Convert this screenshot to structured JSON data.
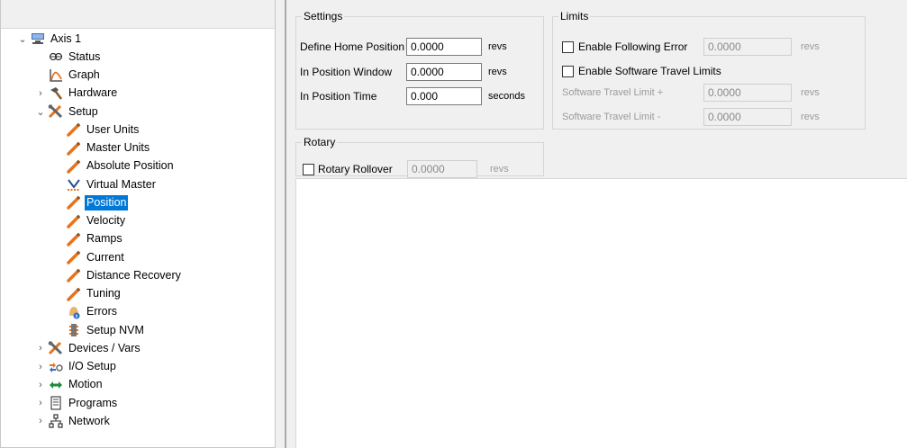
{
  "tree": {
    "items": [
      {
        "label": "Axis 1",
        "chevron": "⌄",
        "icon": "axis-icon"
      },
      {
        "label": "Status",
        "icon": "status-icon"
      },
      {
        "label": "Graph",
        "icon": "graph-icon"
      },
      {
        "label": "Hardware",
        "chevron": "›",
        "icon": "hardware-icon"
      },
      {
        "label": "Setup",
        "chevron": "⌄",
        "icon": "setup-icon"
      },
      {
        "label": "User Units",
        "icon": "pencil-icon"
      },
      {
        "label": "Master Units",
        "icon": "pencil-icon"
      },
      {
        "label": "Absolute Position",
        "icon": "pencil-icon"
      },
      {
        "label": "Virtual Master",
        "icon": "virtual-master-icon"
      },
      {
        "label": "Position",
        "icon": "pencil-icon",
        "selected": true
      },
      {
        "label": "Velocity",
        "icon": "pencil-icon"
      },
      {
        "label": "Ramps",
        "icon": "pencil-icon"
      },
      {
        "label": "Current",
        "icon": "pencil-icon"
      },
      {
        "label": "Distance Recovery",
        "icon": "pencil-icon"
      },
      {
        "label": "Tuning",
        "icon": "pencil-icon"
      },
      {
        "label": "Errors",
        "icon": "errors-icon"
      },
      {
        "label": "Setup NVM",
        "icon": "nvm-icon"
      },
      {
        "label": "Devices / Vars",
        "chevron": "›",
        "icon": "devices-icon"
      },
      {
        "label": "I/O Setup",
        "chevron": "›",
        "icon": "io-icon"
      },
      {
        "label": "Motion",
        "chevron": "›",
        "icon": "motion-icon"
      },
      {
        "label": "Programs",
        "chevron": "›",
        "icon": "programs-icon"
      },
      {
        "label": "Network",
        "chevron": "›",
        "icon": "network-icon"
      }
    ]
  },
  "settings": {
    "title": "Settings",
    "define_home_label": "Define Home Position",
    "define_home_value": "0.0000",
    "define_home_unit": "revs",
    "in_position_window_label": "In Position Window",
    "in_position_window_value": "0.0000",
    "in_position_window_unit": "revs",
    "in_position_time_label": "In Position Time",
    "in_position_time_value": "0.000",
    "in_position_time_unit": "seconds"
  },
  "limits": {
    "title": "Limits",
    "enable_following_error_label": "Enable Following Error",
    "following_error_value": "0.0000",
    "following_error_unit": "revs",
    "enable_software_travel_label": "Enable Software Travel Limits",
    "travel_limit_plus_label": "Software Travel Limit +",
    "travel_limit_plus_value": "0.0000",
    "travel_limit_plus_unit": "revs",
    "travel_limit_minus_label": "Software Travel Limit -",
    "travel_limit_minus_value": "0.0000",
    "travel_limit_minus_unit": "revs"
  },
  "rotary": {
    "title": "Rotary",
    "rollover_label": "Rotary Rollover",
    "rollover_value": "0.0000",
    "rollover_unit": "revs"
  },
  "colors": {
    "selection": "#0078d7",
    "pencil": "#e8731c",
    "panel_bg": "#f0f0f0"
  }
}
